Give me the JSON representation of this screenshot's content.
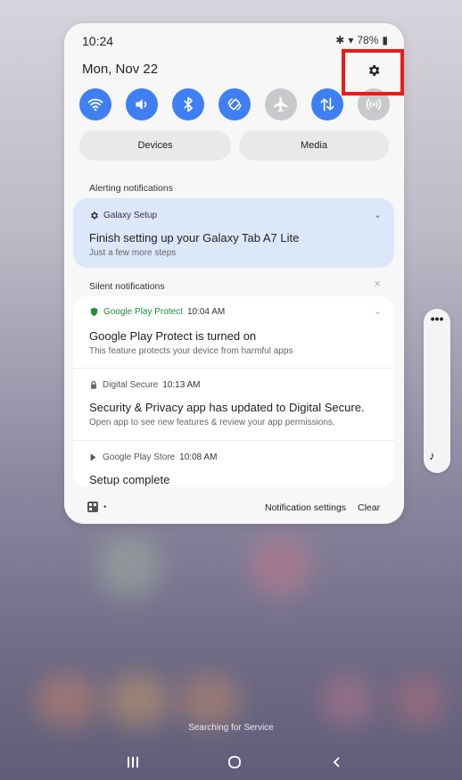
{
  "status_bar": {
    "time": "10:24",
    "battery": "78%"
  },
  "header": {
    "date": "Mon, Nov 22"
  },
  "quick_settings": [
    {
      "name": "wifi-icon",
      "state": "on"
    },
    {
      "name": "sound-icon",
      "state": "on"
    },
    {
      "name": "bluetooth-icon",
      "state": "on"
    },
    {
      "name": "auto-rotate-icon",
      "state": "on"
    },
    {
      "name": "airplane-icon",
      "state": "off"
    },
    {
      "name": "mobile-data-icon",
      "state": "on"
    },
    {
      "name": "hotspot-icon",
      "state": "off"
    }
  ],
  "tabs": {
    "devices": "Devices",
    "media": "Media"
  },
  "alerting": {
    "label": "Alerting notifications",
    "app": "Galaxy Setup",
    "title": "Finish setting up your Galaxy Tab A7 Lite",
    "subtitle": "Just a few more steps"
  },
  "silent": {
    "label": "Silent notifications",
    "items": [
      {
        "app": "Google Play Protect",
        "time": "10:04 AM",
        "title": "Google Play Protect is turned on",
        "subtitle": "This feature protects your device from harmful apps"
      },
      {
        "app": "Digital Secure",
        "time": "10:13 AM",
        "title": "Security & Privacy app has updated to Digital Secure.",
        "subtitle": "Open app to see new features & review your app permissions."
      },
      {
        "app": "Google Play Store",
        "time": "10:08 AM",
        "title": "Setup complete",
        "subtitle": ""
      }
    ]
  },
  "footer": {
    "settings": "Notification settings",
    "clear": "Clear"
  },
  "bottom": {
    "status": "Searching for Service"
  },
  "colors": {
    "accent": "#3e7ff3",
    "highlight": "#f01818",
    "protect_green": "#1e8e3e"
  }
}
